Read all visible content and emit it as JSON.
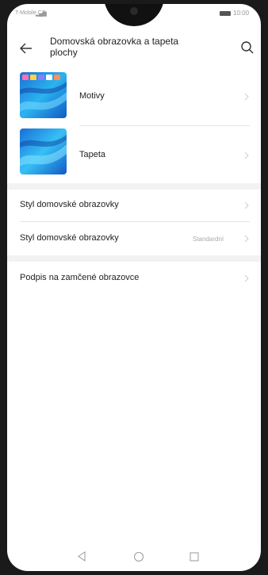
{
  "status_bar": {
    "carrier": "T-Mobile CZ",
    "signal": "▂▄▆",
    "time": "10:00"
  },
  "header": {
    "title": "Domovská obrazovka a tapeta plochy"
  },
  "items": [
    {
      "label": "Motivy"
    },
    {
      "label": "Tapeta"
    },
    {
      "label": "Styl domovské obrazovky"
    },
    {
      "label": "Styl domovské obrazovky",
      "value": "Standardní"
    },
    {
      "label": "Podpis na zamčené obrazovce"
    }
  ],
  "colors": {
    "background": "#ffffff",
    "section_gap": "#f2f2f2",
    "text": "#222222",
    "secondary_text": "#aaaaaa"
  },
  "navigation": {
    "icons": [
      "back-triangle-icon",
      "home-circle-icon",
      "recents-square-icon"
    ]
  }
}
